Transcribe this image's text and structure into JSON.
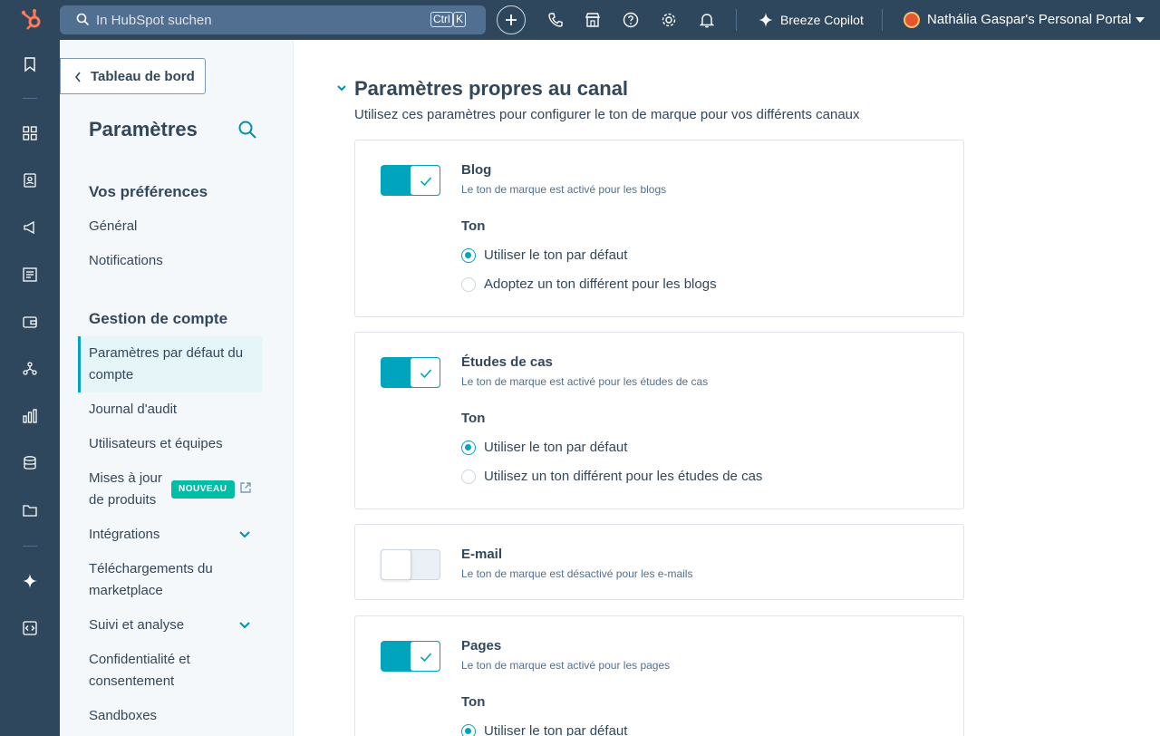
{
  "topbar": {
    "search_placeholder": "In HubSpot suchen",
    "kbd_ctrl": "Ctrl",
    "kbd_key": "K",
    "copilot_label": "Breeze Copilot",
    "portal_name": "Nathália Gaspar's Personal Portal"
  },
  "sidebar": {
    "back_label": "Tableau de bord",
    "title": "Paramètres",
    "section_preferences": "Vos préférences",
    "section_account": "Gestion de compte",
    "items": {
      "general": "Général",
      "notifications": "Notifications",
      "account_defaults": "Paramètres par défaut du compte",
      "audit_log": "Journal d'audit",
      "users_teams": "Utilisateurs et équipes",
      "product_updates": "Mises à jour de produits",
      "product_updates_badge": "NOUVEAU",
      "integrations": "Intégrations",
      "marketplace_downloads": "Téléchargements du marketplace",
      "tracking_analytics": "Suivi et analyse",
      "privacy_consent": "Confidentialité et consentement",
      "sandboxes": "Sandboxes"
    }
  },
  "main": {
    "section_title": "Paramètres propres au canal",
    "section_desc": "Utilisez ces paramètres pour configurer le ton de marque pour vos différents canaux",
    "cards": [
      {
        "title": "Blog",
        "subtitle": "Le ton de marque est activé pour les blogs",
        "enabled": true,
        "ton_label": "Ton",
        "option_default": "Utiliser le ton par défaut",
        "option_custom": "Adoptez un ton différent pour les blogs"
      },
      {
        "title": "Études de cas",
        "subtitle": "Le ton de marque est activé pour les études de cas",
        "enabled": true,
        "ton_label": "Ton",
        "option_default": "Utiliser le ton par défaut",
        "option_custom": "Utilisez un ton différent pour les études de cas"
      },
      {
        "title": "E-mail",
        "subtitle": "Le ton de marque est désactivé pour les e-mails",
        "enabled": false
      },
      {
        "title": "Pages",
        "subtitle": "Le ton de marque est activé pour les pages",
        "enabled": true,
        "ton_label": "Ton",
        "option_default": "Utiliser le ton par défaut"
      }
    ]
  },
  "colors": {
    "nav_bg": "#2e475d",
    "accent": "#00a4bd",
    "brand_orange": "#ff7a59",
    "badge": "#00bda5"
  }
}
